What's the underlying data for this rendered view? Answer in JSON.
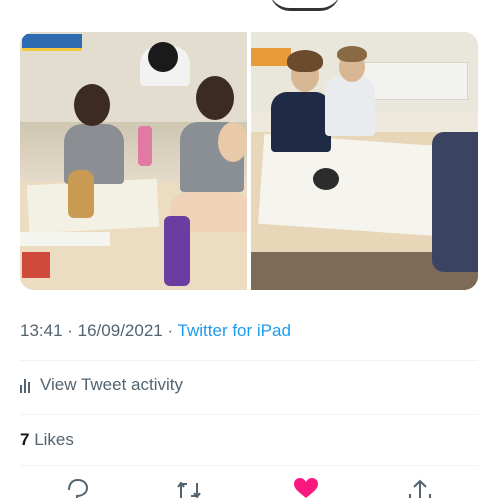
{
  "tweet": {
    "timestamp": "13:41 · 16/09/2021",
    "separator": " · ",
    "source": "Twitter for iPad",
    "activity_label": "View Tweet activity",
    "likes_count": "7",
    "likes_label": "Likes"
  },
  "media": {
    "photos": [
      "classroom-photo-1",
      "classroom-photo-2"
    ]
  },
  "actions": [
    {
      "icon": "reply-icon"
    },
    {
      "icon": "retweet-icon"
    },
    {
      "icon": "like-icon-filled",
      "color": "#f91880"
    },
    {
      "icon": "share-icon"
    }
  ],
  "colors": {
    "link": "#1d9bf0",
    "secondary_text": "#536471",
    "like": "#f91880"
  }
}
